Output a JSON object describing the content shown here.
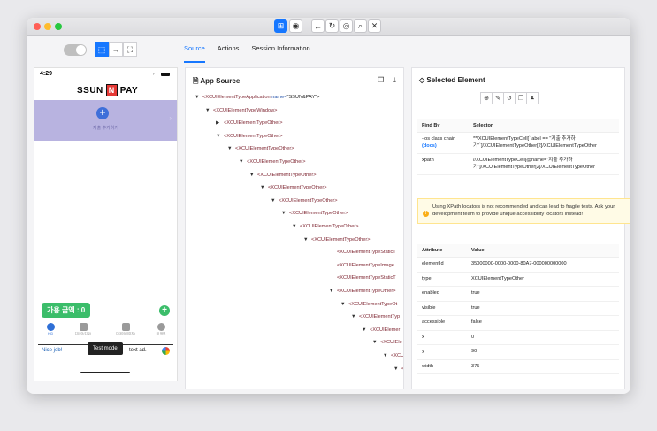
{
  "phone": {
    "time": "4:29",
    "logo_left": "SSUN",
    "logo_mid": "N",
    "logo_right": "PAY",
    "add_label": "지출 추가하기",
    "balance": "가용 금액 : 0",
    "nav": [
      "HID",
      "디데이(디오)",
      "디데이(이미지)",
      "내 정보"
    ],
    "ad_text": "Nice job!",
    "ad_suffix": "text ad.",
    "test_mode": "Test mode"
  },
  "tabs": [
    "Source",
    "Actions",
    "Session Information"
  ],
  "source": {
    "title": "App Source",
    "nodes": [
      {
        "tw": "▼",
        "tag": "<XCUIElementTypeApplication ",
        "attr": "name=",
        "val": "\"SSUN&PAY\">"
      },
      {
        "tw": "▼",
        "tag": "<XCUIElementTypeWindow>"
      },
      {
        "tw": "▶",
        "tag": "<XCUIElementTypeOther>"
      },
      {
        "tw": "▼",
        "tag": "<XCUIElementTypeOther>"
      },
      {
        "tw": "▼",
        "tag": "<XCUIElementTypeOther>"
      },
      {
        "tw": "▼",
        "tag": "<XCUIElementTypeOther>"
      },
      {
        "tw": "▼",
        "tag": "<XCUIElementTypeOther>"
      },
      {
        "tw": "▼",
        "tag": "<XCUIElementTypeOther>"
      },
      {
        "tw": "▼",
        "tag": "<XCUIElementTypeOther>"
      },
      {
        "tw": "▼",
        "tag": "<XCUIElementTypeOther>"
      },
      {
        "tw": "▼",
        "tag": "<XCUIElementTypeOther>"
      },
      {
        "tw": "▼",
        "tag": "<XCUIElementTypeOther>"
      },
      {
        "tw": "",
        "tag": "<XCUIElementTypeStaticT"
      },
      {
        "tw": "",
        "tag": "<XCUIElementTypeImage"
      },
      {
        "tw": "",
        "tag": "<XCUIElementTypeStaticT"
      },
      {
        "tw": "▼",
        "tag": "<XCUIElementTypeOther>"
      },
      {
        "tw": "▼",
        "tag": "<XCUIElementTypeOt"
      },
      {
        "tw": "▼",
        "tag": "<XCUIElementTyp"
      },
      {
        "tw": "▼",
        "tag": "<XCUIElemer"
      },
      {
        "tw": "▼",
        "tag": "<XCUIEle"
      },
      {
        "tw": "▼",
        "tag": "<XCU"
      },
      {
        "tw": "▼",
        "tag": "<"
      }
    ]
  },
  "selected": {
    "title": "Selected Element",
    "find_by_header": "Find By",
    "selector_header": "Selector",
    "rows": [
      {
        "by": "-ios class chain",
        "docs": "(docs)",
        "sel": "**/XCUIElementTypeCell[`label == \"지출 추가하기\"`]/XCUIElementTypeOther[2]/XCUIElementTypeOther"
      },
      {
        "by": "xpath",
        "sel": "//XCUIElementTypeCell[@name=\"지출 추가하기\"]/XCUIElementTypeOther[2]/XCUIElementTypeOther"
      }
    ],
    "warning": "Using XPath locators is not recommended and can lead to fragile tests. Ask your development team to provide unique accessibility locators instead!",
    "attr_header": "Attribute",
    "value_header": "Value",
    "attributes": [
      {
        "k": "elementId",
        "v": "35000000-0000-0000-80A7-000000000000"
      },
      {
        "k": "type",
        "v": "XCUIElementTypeOther"
      },
      {
        "k": "enabled",
        "v": "true"
      },
      {
        "k": "visible",
        "v": "true"
      },
      {
        "k": "accessible",
        "v": "false"
      },
      {
        "k": "x",
        "v": "0"
      },
      {
        "k": "y",
        "v": "90"
      },
      {
        "k": "width",
        "v": "375"
      }
    ]
  }
}
